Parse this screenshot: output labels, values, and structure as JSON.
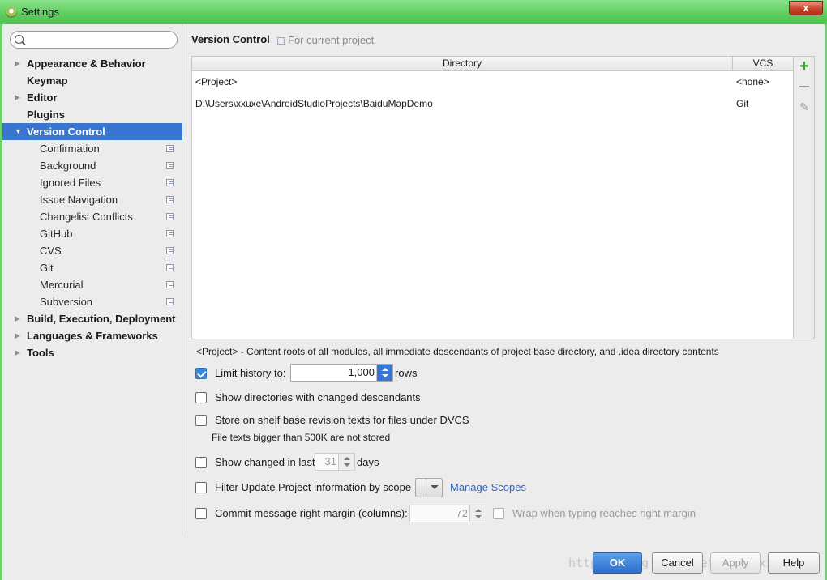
{
  "window": {
    "title": "Settings",
    "close_symbol": "x",
    "accent": "#5ccc5c"
  },
  "sidebar": {
    "search_placeholder": "",
    "items": [
      {
        "label": "Appearance & Behavior",
        "level": "top",
        "expandable": true,
        "expanded": false
      },
      {
        "label": "Keymap",
        "level": "top",
        "expandable": false
      },
      {
        "label": "Editor",
        "level": "top",
        "expandable": true,
        "expanded": false
      },
      {
        "label": "Plugins",
        "level": "top",
        "expandable": false
      },
      {
        "label": "Version Control",
        "level": "top",
        "expandable": true,
        "expanded": true,
        "selected": true
      },
      {
        "label": "Confirmation",
        "level": "sub",
        "project_icon": true
      },
      {
        "label": "Background",
        "level": "sub",
        "project_icon": true
      },
      {
        "label": "Ignored Files",
        "level": "sub",
        "project_icon": true
      },
      {
        "label": "Issue Navigation",
        "level": "sub",
        "project_icon": true
      },
      {
        "label": "Changelist Conflicts",
        "level": "sub",
        "project_icon": true
      },
      {
        "label": "GitHub",
        "level": "sub",
        "project_icon": true
      },
      {
        "label": "CVS",
        "level": "sub",
        "project_icon": true
      },
      {
        "label": "Git",
        "level": "sub",
        "project_icon": true
      },
      {
        "label": "Mercurial",
        "level": "sub",
        "project_icon": true
      },
      {
        "label": "Subversion",
        "level": "sub",
        "project_icon": true
      },
      {
        "label": "Build, Execution, Deployment",
        "level": "top",
        "expandable": true,
        "expanded": false
      },
      {
        "label": "Languages & Frameworks",
        "level": "top",
        "expandable": true,
        "expanded": false
      },
      {
        "label": "Tools",
        "level": "top",
        "expandable": true,
        "expanded": false
      }
    ]
  },
  "main": {
    "heading": "Version Control",
    "scope_note": "For current project",
    "table": {
      "columns": [
        "Directory",
        "VCS"
      ],
      "rows": [
        {
          "directory": "<Project>",
          "vcs": "<none>"
        },
        {
          "directory": "D:\\Users\\xxuxe\\AndroidStudioProjects\\BaiduMapDemo",
          "vcs": "Git"
        }
      ]
    },
    "toolbar_icons": [
      "plus-icon",
      "minus-icon",
      "edit-icon"
    ],
    "legend": "<Project> - Content roots of all modules, all immediate descendants of project base directory, and .idea directory contents",
    "options": {
      "limit_history": {
        "label": "Limit history to:",
        "checked": true,
        "value": "1,000",
        "suffix": "rows"
      },
      "show_dirs": {
        "label": "Show directories with changed descendants",
        "checked": false
      },
      "store_shelf": {
        "label": "Store on shelf base revision texts for files under DVCS",
        "checked": false,
        "note": "File texts bigger than 500K are not stored"
      },
      "show_changed": {
        "label": "Show changed in last",
        "checked": false,
        "value": "31",
        "suffix": "days"
      },
      "filter_update": {
        "label": "Filter Update Project information by scope",
        "checked": false,
        "selected": "",
        "link": "Manage Scopes"
      },
      "commit_margin": {
        "label": "Commit message right margin (columns):",
        "checked": false,
        "value": "72",
        "wrap_label": "Wrap when typing reaches right margin",
        "wrap_checked": false
      }
    }
  },
  "footer": {
    "ok": "OK",
    "cancel": "Cancel",
    "apply": "Apply",
    "help": "Help",
    "watermark": "http://blog.csdn.net/xxxxxxxxxxx"
  }
}
